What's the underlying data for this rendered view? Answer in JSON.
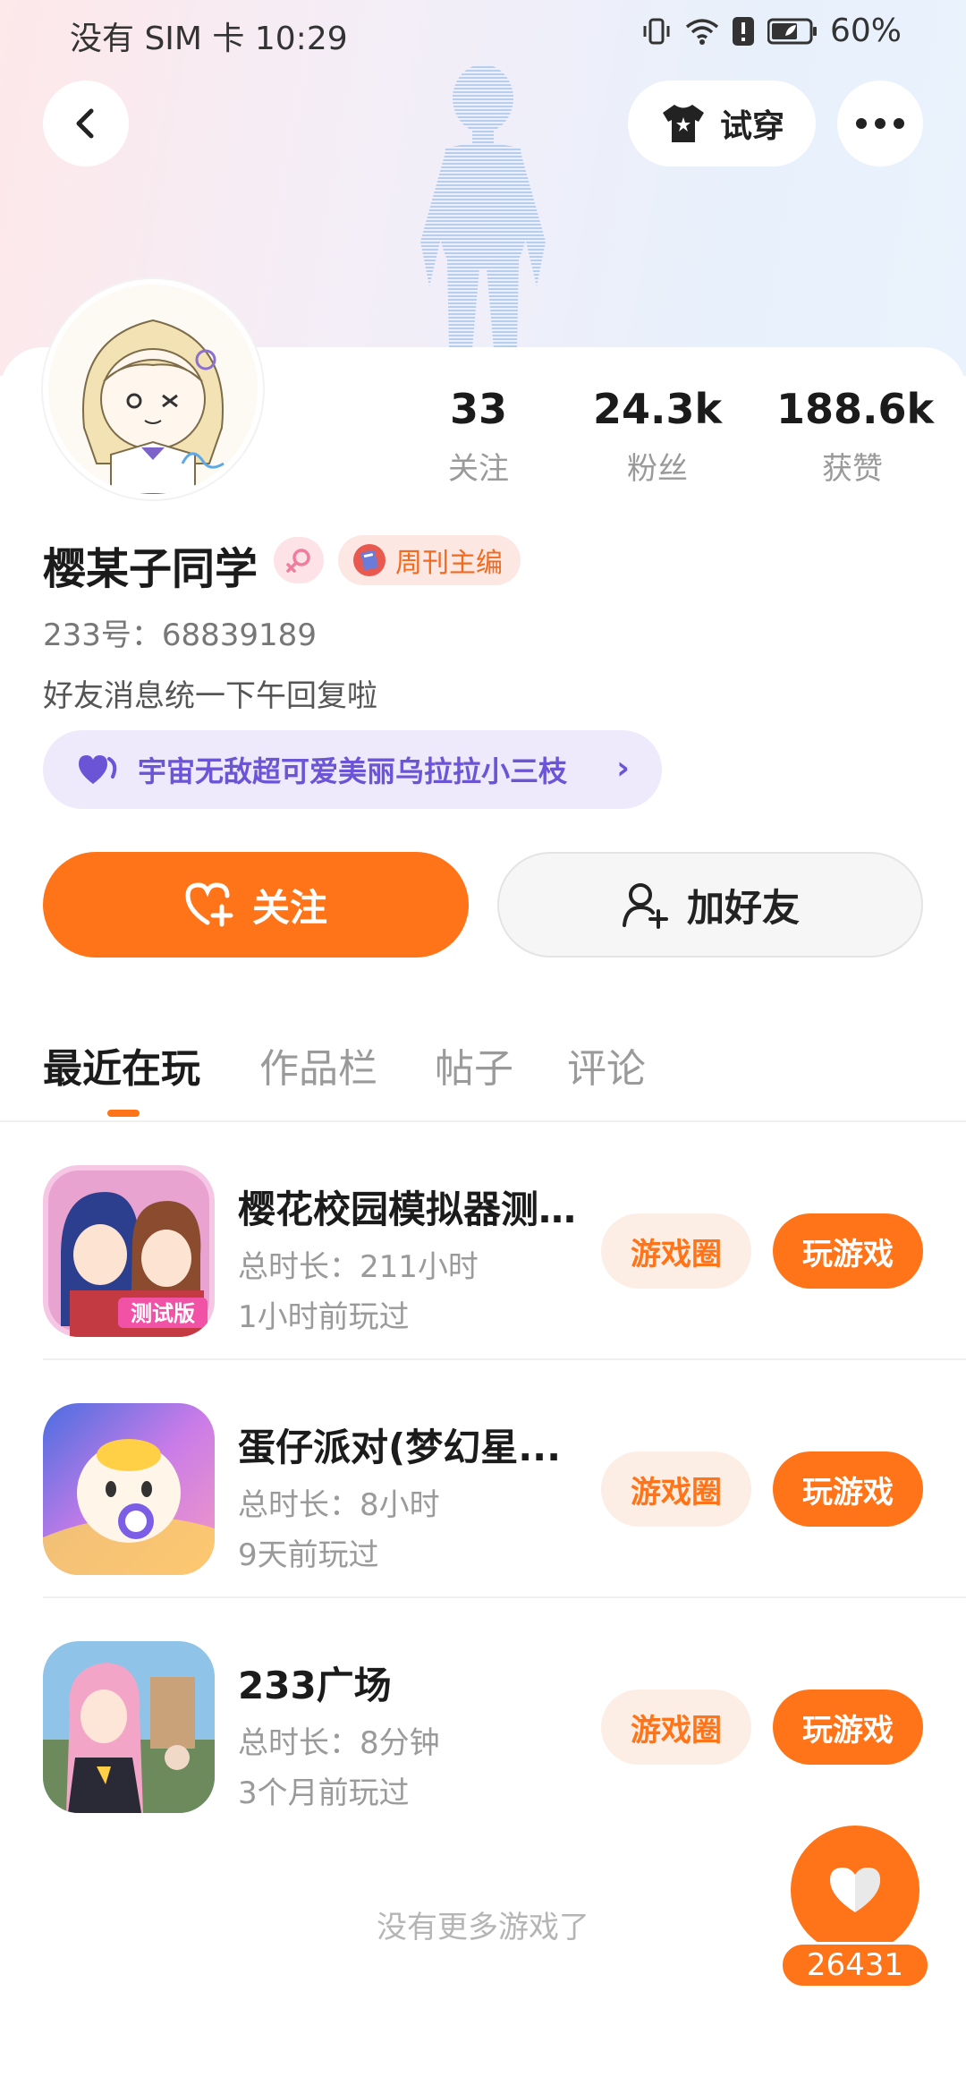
{
  "status_bar": {
    "carrier": "没有 SIM 卡",
    "time": "10:29",
    "battery": "60%"
  },
  "header": {
    "try_on_label": "试穿"
  },
  "stats": [
    {
      "value": "33",
      "label": "关注"
    },
    {
      "value": "24.3k",
      "label": "粉丝"
    },
    {
      "value": "188.6k",
      "label": "获赞"
    }
  ],
  "profile": {
    "username": "樱某子同学",
    "badge": "周刊主编",
    "uid": "233号：68839189",
    "bio": "好友消息统一下午回复啦",
    "bond_name": "宇宙无敌超可爱美丽乌拉拉小三枝"
  },
  "actions": {
    "follow": "关注",
    "add_friend": "加好友"
  },
  "tabs": [
    "最近在玩",
    "作品栏",
    "帖子",
    "评论"
  ],
  "games": [
    {
      "title": "樱花校园模拟器测...",
      "duration": "总时长：211小时",
      "last_played": "1小时前玩过",
      "circle_label": "游戏圈",
      "play_label": "玩游戏"
    },
    {
      "title": "蛋仔派对(梦幻星...",
      "duration": "总时长：8小时",
      "last_played": "9天前玩过",
      "circle_label": "游戏圈",
      "play_label": "玩游戏"
    },
    {
      "title": "233广场",
      "duration": "总时长：8分钟",
      "last_played": "3个月前玩过",
      "circle_label": "游戏圈",
      "play_label": "玩游戏"
    }
  ],
  "footer": {
    "no_more": "没有更多游戏了"
  },
  "like_fab": {
    "count": "26431"
  },
  "colors": {
    "accent": "#ff7418",
    "purple": "#6b54d6",
    "badge_bg": "#fde7e3"
  }
}
